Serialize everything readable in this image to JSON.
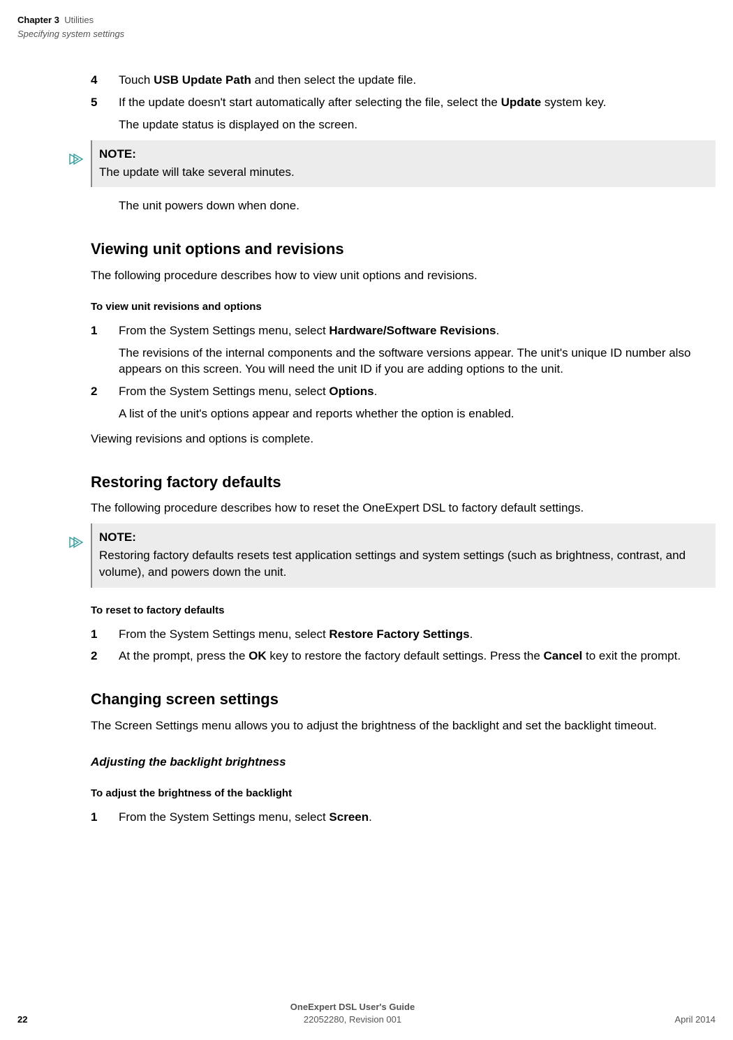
{
  "header": {
    "chapter_label": "Chapter 3",
    "chapter_title": "Utilities",
    "section": "Specifying system settings"
  },
  "steps_top": [
    {
      "num": "4",
      "pre": "Touch ",
      "bold": "USB Update Path",
      "post": " and then select the update file."
    },
    {
      "num": "5",
      "pre": "If the update doesn't start automatically after selecting the file, select the ",
      "bold": "Update",
      "post": " system key.",
      "sub": "The update status is displayed on the screen."
    }
  ],
  "note1": {
    "label": "NOTE:",
    "text": "The update will take several minutes."
  },
  "post_note1": "The unit powers down when done.",
  "section1": {
    "heading": "Viewing unit options and revisions",
    "intro": "The following procedure describes how to view unit options and revisions.",
    "task": "To view unit revisions and options",
    "steps": [
      {
        "num": "1",
        "pre": "From the System Settings menu, select ",
        "bold": "Hardware/Software Revisions",
        "post": ".",
        "sub": "The revisions of the internal components and the software versions appear. The unit's unique ID number also appears on this screen. You will need the unit ID if you are adding options to the unit."
      },
      {
        "num": "2",
        "pre": "From the System Settings menu, select ",
        "bold": "Options",
        "post": ".",
        "sub": "A list of the unit's options appear and reports whether the option is enabled."
      }
    ],
    "closing": "Viewing revisions and options is complete."
  },
  "section2": {
    "heading": "Restoring factory defaults",
    "intro": "The following procedure describes how to reset the OneExpert DSL to factory default settings.",
    "note": {
      "label": "NOTE:",
      "text": "Restoring factory defaults resets test application settings and system settings (such as brightness, contrast, and volume), and powers down the unit."
    },
    "task": "To reset to factory defaults",
    "steps": [
      {
        "num": "1",
        "pre": "From the System Settings menu, select ",
        "bold": "Restore Factory Settings",
        "post": "."
      },
      {
        "num": "2",
        "pre": "At the prompt, press the ",
        "bold": "OK",
        "mid": " key to restore the factory default settings. Press the ",
        "bold2": "Cancel",
        "post": " to exit the prompt."
      }
    ]
  },
  "section3": {
    "heading": "Changing screen settings",
    "intro": "The Screen Settings menu allows you to adjust the brightness of the backlight and set the backlight timeout.",
    "subheading": "Adjusting the backlight brightness",
    "task": "To adjust the brightness of the backlight",
    "steps": [
      {
        "num": "1",
        "pre": "From the System Settings menu, select ",
        "bold": "Screen",
        "post": "."
      }
    ]
  },
  "footer": {
    "page": "22",
    "title": "OneExpert DSL User's Guide",
    "docnum": "22052280, Revision 001",
    "date": "April 2014"
  }
}
